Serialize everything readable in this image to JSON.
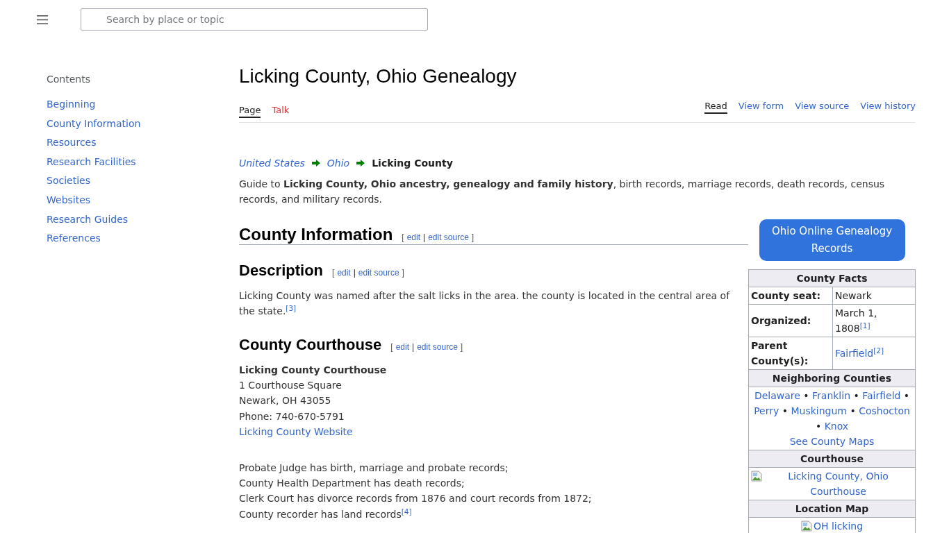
{
  "header": {
    "search": {
      "placeholder": "Search by place or topic"
    }
  },
  "sidebar": {
    "title": "Contents",
    "items": [
      "Beginning",
      "County Information",
      "Resources",
      "Research Facilities",
      "Societies",
      "Websites",
      "Research Guides",
      "References"
    ]
  },
  "page": {
    "title": "Licking County, Ohio Genealogy",
    "namespace_tabs": [
      {
        "label": "Page",
        "selected": true,
        "missing": false
      },
      {
        "label": "Talk",
        "selected": false,
        "missing": true
      }
    ],
    "view_tabs": [
      {
        "label": "Read",
        "selected": true
      },
      {
        "label": "View form",
        "selected": false
      },
      {
        "label": "View source",
        "selected": false
      },
      {
        "label": "View history",
        "selected": false
      }
    ],
    "breadcrumb": [
      {
        "kind": "link",
        "label": "United States"
      },
      {
        "kind": "link",
        "label": "Ohio"
      },
      {
        "kind": "current",
        "label": "Licking County"
      }
    ],
    "intro": "Guide to **Licking County, Ohio ancestry, genealogy and family history**, birth records, marriage records, death records, census records, and military records.",
    "sections": [
      {
        "heading": "County Information",
        "edit_links": [
          {
            "kind": "bracket",
            "text": "["
          },
          {
            "kind": "link",
            "text": "edit"
          },
          {
            "kind": "separator",
            "text": "|"
          },
          {
            "kind": "link",
            "text": "edit source"
          },
          {
            "kind": "bracket",
            "text": "]"
          }
        ],
        "subsections": [
          {
            "heading": "Description",
            "edit_links": [
              {
                "kind": "bracket",
                "text": "["
              },
              {
                "kind": "link",
                "text": "edit"
              },
              {
                "kind": "separator",
                "text": "|"
              },
              {
                "kind": "link",
                "text": "edit source"
              },
              {
                "kind": "bracket",
                "text": "]"
              }
            ],
            "blocks": [
              {
                "kind": "paragraph",
                "text": "Licking County was named after the salt licks in the area. the county is located in the central area of the state.",
                "footnote": "[3]"
              }
            ]
          },
          {
            "heading": "County Courthouse",
            "edit_links": [
              {
                "kind": "bracket",
                "text": "["
              },
              {
                "kind": "link",
                "text": "edit"
              },
              {
                "kind": "separator",
                "text": "|"
              },
              {
                "kind": "link",
                "text": "edit source"
              },
              {
                "kind": "bracket",
                "text": "]"
              }
            ],
            "blocks": [
              {
                "kind": "lines",
                "lines": [
                  {
                    "kind": "bold",
                    "text": "Licking County Courthouse"
                  },
                  {
                    "kind": "plain",
                    "text": "1 Courthouse Square"
                  },
                  {
                    "kind": "plain",
                    "text": "Newark, OH 43055"
                  },
                  {
                    "kind": "plain",
                    "text": "Phone: 740-670-5791"
                  },
                  {
                    "kind": "link",
                    "text": "Licking County Website"
                  }
                ]
              },
              {
                "kind": "lines",
                "lines": [
                  {
                    "kind": "plain",
                    "text": "Probate Judge has birth, marriage and probate records;"
                  },
                  {
                    "kind": "plain",
                    "text": "County Health Department has death records;"
                  },
                  {
                    "kind": "plain",
                    "text": "Clerk Court has divorce records from 1876 and court records from 1872;"
                  },
                  {
                    "kind": "plain",
                    "text": "County recorder has land records",
                    "footnote": "[4]"
                  }
                ]
              }
            ]
          }
        ]
      }
    ]
  },
  "aside": {
    "button": "Ohio Online Genealogy Records",
    "infobox": {
      "rows": [
        {
          "kind": "header",
          "text": "County Facts"
        },
        {
          "kind": "field",
          "label": "County seat:",
          "value": "Newark"
        },
        {
          "kind": "field",
          "label": "Organized:",
          "value": "March 1, 1808",
          "footnote": "[1]"
        },
        {
          "kind": "link_field",
          "label": "Parent County(s):",
          "value": "Fairfield",
          "footnote": "[2]"
        },
        {
          "kind": "header",
          "text": "Neighboring Counties"
        },
        {
          "kind": "links",
          "links": [
            {
              "text": "Delaware",
              "separator": "•"
            },
            {
              "text": "Franklin",
              "separator": "•"
            },
            {
              "text": "Fairfield",
              "separator": "•"
            },
            {
              "text": "Perry",
              "separator": "•"
            },
            {
              "text": "Muskingum",
              "separator": "•"
            },
            {
              "text": "Coshocton",
              "separator": "•"
            },
            {
              "text": "Knox"
            }
          ],
          "footer_link": "See County Maps"
        },
        {
          "kind": "header",
          "text": "Courthouse"
        },
        {
          "kind": "image",
          "alt": "Licking County, Ohio Courthouse"
        },
        {
          "kind": "header",
          "text": "Location Map"
        },
        {
          "kind": "image",
          "alt": "OH licking"
        }
      ]
    }
  }
}
